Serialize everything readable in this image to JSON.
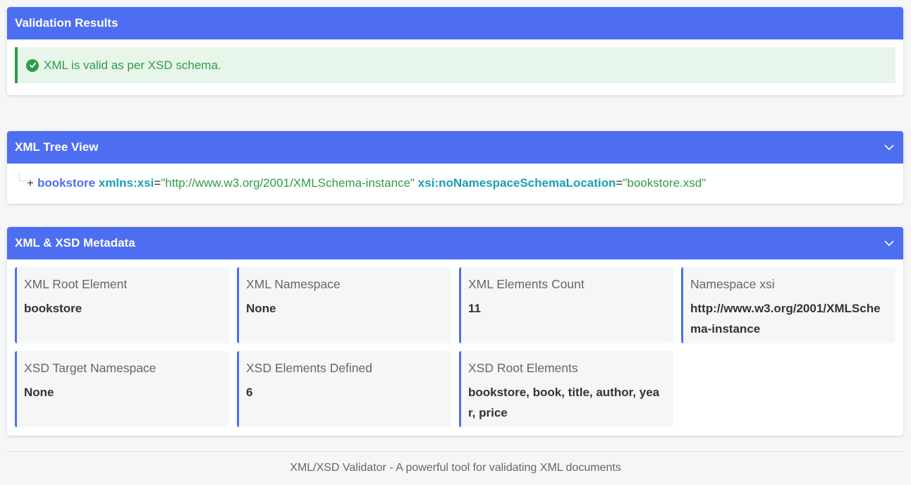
{
  "validation": {
    "header": "Validation Results",
    "message": "XML is valid as per XSD schema.",
    "status_color": "#2e9d46"
  },
  "tree": {
    "header": "XML Tree View",
    "expander": "+",
    "element": "bookstore",
    "attributes": [
      {
        "name": "xmlns:xsi",
        "value": "\"http://www.w3.org/2001/XMLSchema-instance\""
      },
      {
        "name": "xsi:noNamespaceSchemaLocation",
        "value": "\"bookstore.xsd\""
      }
    ]
  },
  "metadata": {
    "header": "XML & XSD Metadata",
    "items": [
      {
        "label": "XML Root Element",
        "value": "bookstore"
      },
      {
        "label": "XML Namespace",
        "value": "None"
      },
      {
        "label": "XML Elements Count",
        "value": "11"
      },
      {
        "label": "Namespace xsi",
        "value": "http://www.w3.org/2001/XMLSchema-instance"
      },
      {
        "label": "XSD Target Namespace",
        "value": "None"
      },
      {
        "label": "XSD Elements Defined",
        "value": "6"
      },
      {
        "label": "XSD Root Elements",
        "value": "bookstore, book, title, author, year, price"
      }
    ]
  },
  "footer": {
    "text": "XML/XSD Validator - A powerful tool for validating XML documents"
  },
  "colors": {
    "accent": "#4e6ef2",
    "success": "#2e9d46",
    "attribute": "#1a9fb4"
  }
}
